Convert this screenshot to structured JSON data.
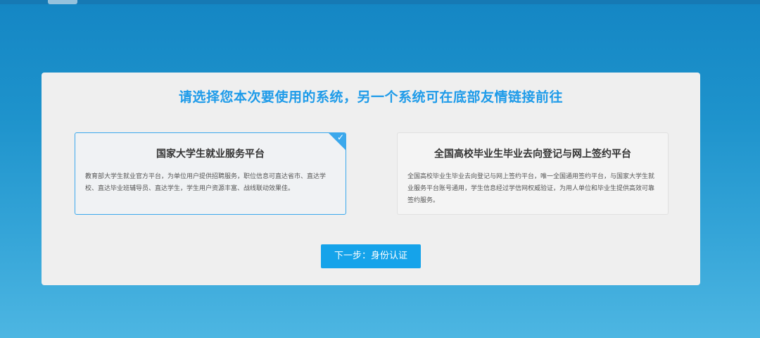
{
  "header": {
    "title": "请选择您本次要使用的系统，另一个系统可在底部友情链接前往"
  },
  "systems": [
    {
      "title": "国家大学生就业服务平台",
      "description": "教育部大学生就业官方平台，为单位用户提供招聘服务，职位信息可直达省市、直达学校、直达毕业班辅导员、直达学生，学生用户资源丰富、战线联动效果佳。",
      "selected": true,
      "check_icon": "check-icon"
    },
    {
      "title": "全国高校毕业生毕业去向登记与网上签约平台",
      "description": "全国高校毕业生毕业去向登记与网上签约平台，唯一全国通用签约平台，与国家大学生就业服务平台账号通用，学生信息经过学信网权威验证，为用人单位和毕业生提供高效可靠签约服务。",
      "selected": false
    }
  ],
  "actions": {
    "next_label": "下一步：身份认证"
  },
  "colors": {
    "accent": "#1e9be9",
    "button": "#15a3ea",
    "selected_border": "#3ba8ec",
    "background_top": "#1486c4",
    "background_bottom": "#4db6e2"
  }
}
